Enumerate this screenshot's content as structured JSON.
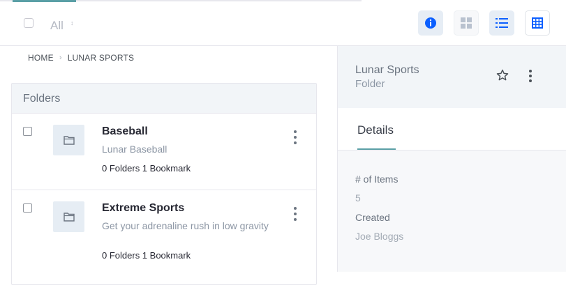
{
  "toolbar": {
    "filter_label": "All",
    "filter_caret": "↕"
  },
  "icons": {
    "info": "info-icon",
    "cards_view": "cards-view-icon",
    "list_view": "list-view-icon",
    "table_view": "table-view-icon",
    "folder": "folder-icon",
    "star": "star-icon",
    "kebab": "ellipsis-v-icon"
  },
  "breadcrumb": {
    "items": [
      "HOME",
      "LUNAR SPORTS"
    ],
    "separator": "›"
  },
  "folders": {
    "header": "Folders",
    "rows": [
      {
        "title": "Baseball",
        "subtitle": "Lunar Baseball",
        "meta": "0 Folders 1 Bookmark"
      },
      {
        "title": "Extreme Sports",
        "subtitle": "Get your adrenaline rush in low gravity",
        "meta": "0 Folders 1 Bookmark"
      }
    ]
  },
  "sidebar": {
    "title": "Lunar Sports",
    "subtitle": "Folder",
    "tab": "Details",
    "details": [
      {
        "label": "# of Items",
        "value": "5"
      },
      {
        "label": "Created",
        "value": "Joe Bloggs"
      }
    ]
  },
  "colors": {
    "accent": "#5a9fa6",
    "primary_icon": "#0b5fff",
    "panel_header": "#f2f5f8"
  }
}
